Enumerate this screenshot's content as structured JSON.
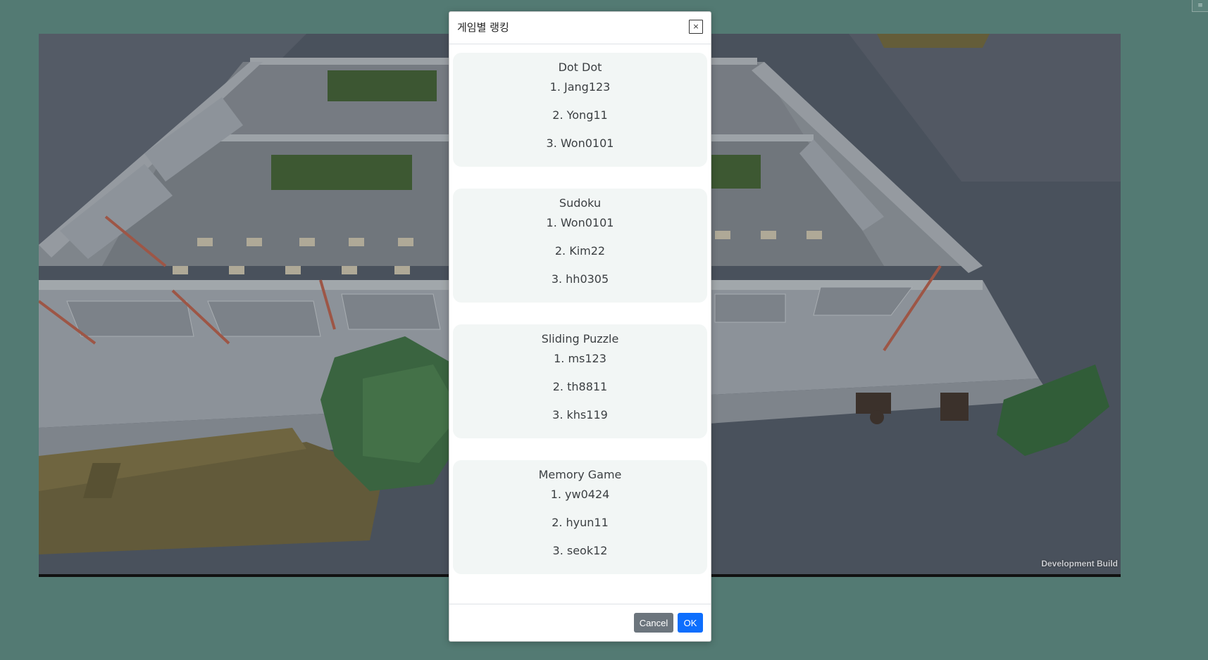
{
  "app": {
    "corner_label": "≡",
    "watermark": "Development Build"
  },
  "modal": {
    "title": "게임별 랭킹",
    "close_label": "×",
    "cancel_label": "Cancel",
    "ok_label": "OK",
    "rankings": [
      {
        "game": "Dot Dot",
        "entries": [
          "1. Jang123",
          "2. Yong11",
          "3. Won0101"
        ]
      },
      {
        "game": "Sudoku",
        "entries": [
          "1. Won0101",
          "2. Kim22",
          "3. hh0305"
        ]
      },
      {
        "game": "Sliding Puzzle",
        "entries": [
          "1. ms123",
          "2. th8811",
          "3. khs119"
        ]
      },
      {
        "game": "Memory Game",
        "entries": [
          "1. yw0424",
          "2. hyun11",
          "3. seok12"
        ]
      }
    ]
  },
  "colors": {
    "page_background": "#537a73",
    "card_background": "#f2f6f5",
    "cancel_button": "#6c757d",
    "ok_button": "#0d6efd"
  }
}
